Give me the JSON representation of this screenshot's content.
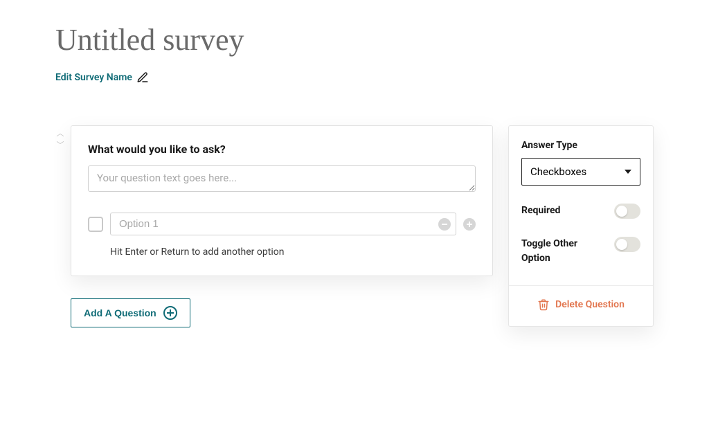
{
  "survey": {
    "title": "Untitled survey",
    "edit_name_label": "Edit Survey Name"
  },
  "question": {
    "prompt_label": "What would you like to ask?",
    "placeholder": "Your question text goes here...",
    "options": [
      {
        "placeholder": "Option 1"
      }
    ],
    "option_hint": "Hit Enter or Return to add another option"
  },
  "actions": {
    "add_question_label": "Add A Question"
  },
  "sidebar": {
    "answer_type_label": "Answer Type",
    "answer_type_value": "Checkboxes",
    "required_label": "Required",
    "toggle_other_label": "Toggle Other Option",
    "delete_label": "Delete Question"
  }
}
